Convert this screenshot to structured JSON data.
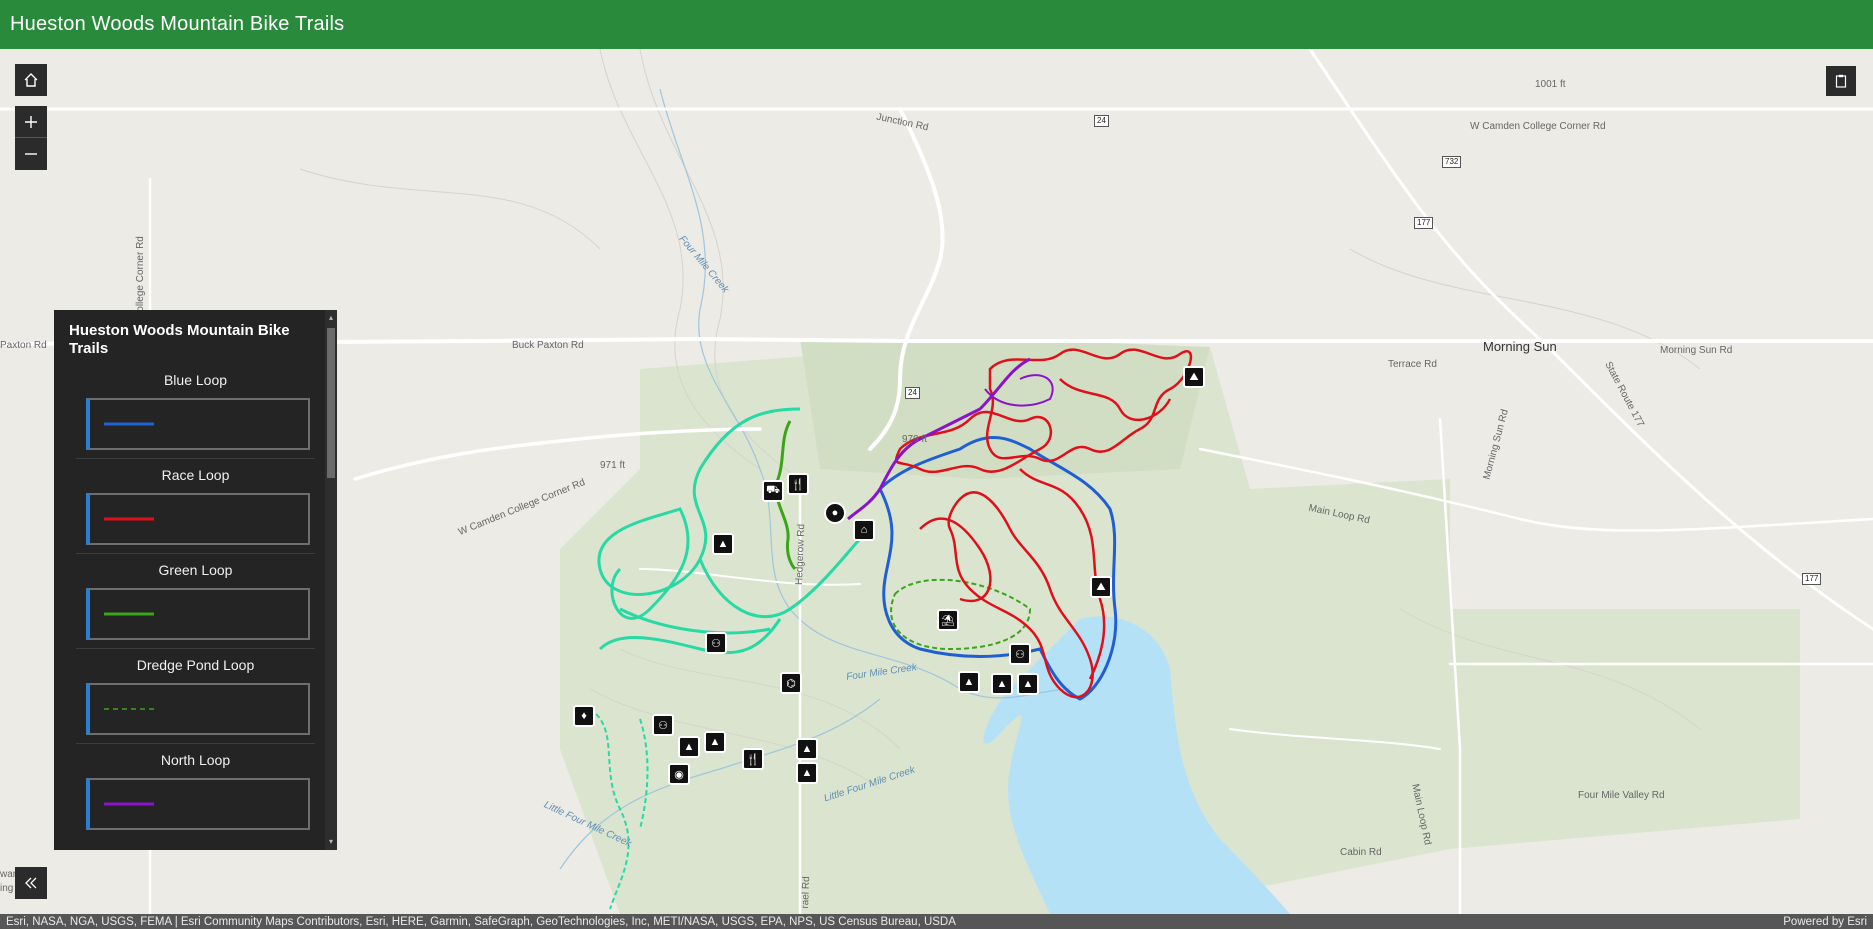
{
  "app": {
    "title": "Hueston Woods Mountain Bike Trails"
  },
  "controls": {
    "home_icon": "home-icon",
    "zoom_in_icon": "plus-icon",
    "zoom_out_icon": "minus-icon",
    "collapse_icon": "double-chevron-left-icon",
    "layers_icon": "clipboard-icon"
  },
  "legend": {
    "title": "Hueston Woods Mountain Bike Trails",
    "items": [
      {
        "label": "Blue Loop",
        "color": "#1f5fd1",
        "style": "solid"
      },
      {
        "label": "Race Loop",
        "color": "#e0101a",
        "style": "solid"
      },
      {
        "label": "Green Loop",
        "color": "#3aa51a",
        "style": "solid"
      },
      {
        "label": "Dredge Pond Loop",
        "color": "#3aa51a",
        "style": "dashed"
      },
      {
        "label": "North Loop",
        "color": "#8a14c9",
        "style": "solid"
      }
    ]
  },
  "map_labels": {
    "junction_rd": "Junction Rd",
    "w_camden_college_corner_rd_ne": "W Camden College Corner Rd",
    "buck_paxton_rd": "Buck Paxton Rd",
    "paxton_rd": "Paxton Rd",
    "college_corner_rd": "en College Corner Rd",
    "four_mile_creek": "Four Mile Creek",
    "four_mile_creek_2": "Four Mile Creek",
    "morning_sun": "Morning Sun",
    "morning_sun_rd": "Morning Sun Rd",
    "morning_sun_rd_2": "Morning Sun Rd",
    "terrace_rd": "Terrace Rd",
    "state_route_177": "State Route 177",
    "main_loop_rd": "Main Loop Rd",
    "main_loop_rd_2": "Main Loop Rd",
    "four_mile_valley_rd": "Four Mile Valley Rd",
    "cabin_rd": "Cabin Rd",
    "hedgerow_rd": "Hedgerow Rd",
    "little_four_mile_creek": "Little Four Mile Creek",
    "little_four_mile_creek_2": "Little Four Mile Creek",
    "w_camden_college_corner_rd_sw": "W Camden College Corner Rd",
    "elev_1001": "1001 ft",
    "elev_971": "971 ft",
    "elev_979": "979 ft",
    "route_24": "24",
    "route_24b": "24",
    "route_732": "732",
    "route_177": "177",
    "route_177b": "177",
    "brael_rd": "rael Rd",
    "side_text_1": "war",
    "side_text_2": "ing"
  },
  "attribution": {
    "sources": "Esri, NASA, NGA, USGS, FEMA | Esri Community Maps Contributors, Esri, HERE, Garmin, SafeGraph, GeoTechnologies, Inc, METI/NASA, USGS, EPA, NPS, US Census Bureau, USDA",
    "powered_by": "Powered by Esri"
  }
}
